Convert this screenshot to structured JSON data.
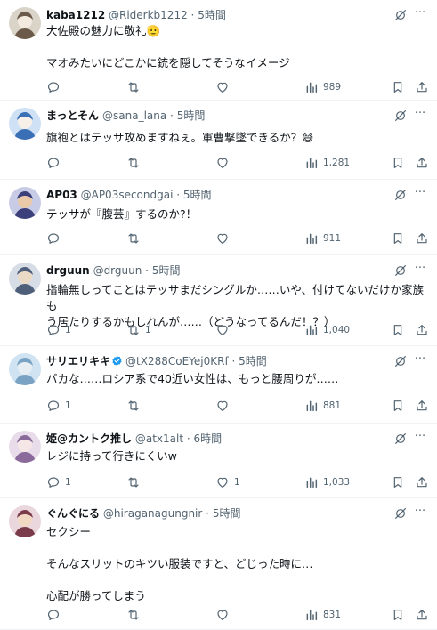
{
  "colors": {
    "text": "#0f1419",
    "muted": "#536471",
    "divider": "#eff3f4",
    "verified": "#1d9bf0"
  },
  "tweets": [
    {
      "name": "kaba1212",
      "handle": "@Riderkb1212",
      "sep": "·",
      "time": "5時間",
      "verified": false,
      "lines": [
        "大佐殿の魅力に敬礼🫡",
        "",
        "マオみたいにどこかに銃を隠してそうなイメージ"
      ],
      "reply_count": "",
      "retweet_count": "",
      "like_count": "",
      "views": "989",
      "avatar_icon": "avatar-icon"
    },
    {
      "name": "まっとそん",
      "handle": "@sana_lana",
      "sep": "·",
      "time": "5時間",
      "verified": false,
      "lines": [
        "旗袍とはテッサ攻めますねぇ。軍曹撃墜できるか？😅"
      ],
      "reply_count": "",
      "retweet_count": "",
      "like_count": "",
      "views": "1,281",
      "avatar_icon": "avatar-icon"
    },
    {
      "name": "AP03",
      "handle": "@AP03secondgai",
      "sep": "·",
      "time": "5時間",
      "verified": false,
      "lines": [
        "テッサが『腹芸』するのか?！"
      ],
      "reply_count": "",
      "retweet_count": "",
      "like_count": "",
      "views": "911",
      "avatar_icon": "avatar-icon"
    },
    {
      "name": "drguun",
      "handle": "@drguun",
      "sep": "·",
      "time": "5時間",
      "verified": false,
      "lines": [
        "指輪無しってことはテッサまだシングルか……いや、付けてないだけか家族も",
        "う居たりするかもしれんが……（どうなってるんだ！？）"
      ],
      "reply_count": "1",
      "retweet_count": "1",
      "like_count": "",
      "views": "1,040",
      "avatar_icon": "avatar-icon"
    },
    {
      "name": "サリエリキキ",
      "handle": "@tX288CoEYej0KRf",
      "sep": "·",
      "time": "5時間",
      "verified": true,
      "lines": [
        "バカな……ロシア系で40近い女性は、もっと腰周りが……"
      ],
      "reply_count": "1",
      "retweet_count": "",
      "like_count": "",
      "views": "881",
      "avatar_icon": "avatar-icon"
    },
    {
      "name": "姫@カントク推し",
      "handle": "@atx1alt",
      "sep": "·",
      "time": "6時間",
      "verified": false,
      "lines": [
        "レジに持って行きにくいw"
      ],
      "reply_count": "1",
      "retweet_count": "",
      "like_count": "1",
      "views": "1,033",
      "avatar_icon": "avatar-icon"
    },
    {
      "name": "ぐんぐにる",
      "handle": "@hiraganagungnir",
      "sep": "·",
      "time": "5時間",
      "verified": false,
      "lines": [
        "セクシー",
        "",
        "そんなスリットのキツい服装ですと、どじった時に…",
        "",
        "心配が勝ってしまう"
      ],
      "reply_count": "",
      "retweet_count": "",
      "like_count": "",
      "views": "831",
      "avatar_icon": "avatar-icon"
    }
  ]
}
